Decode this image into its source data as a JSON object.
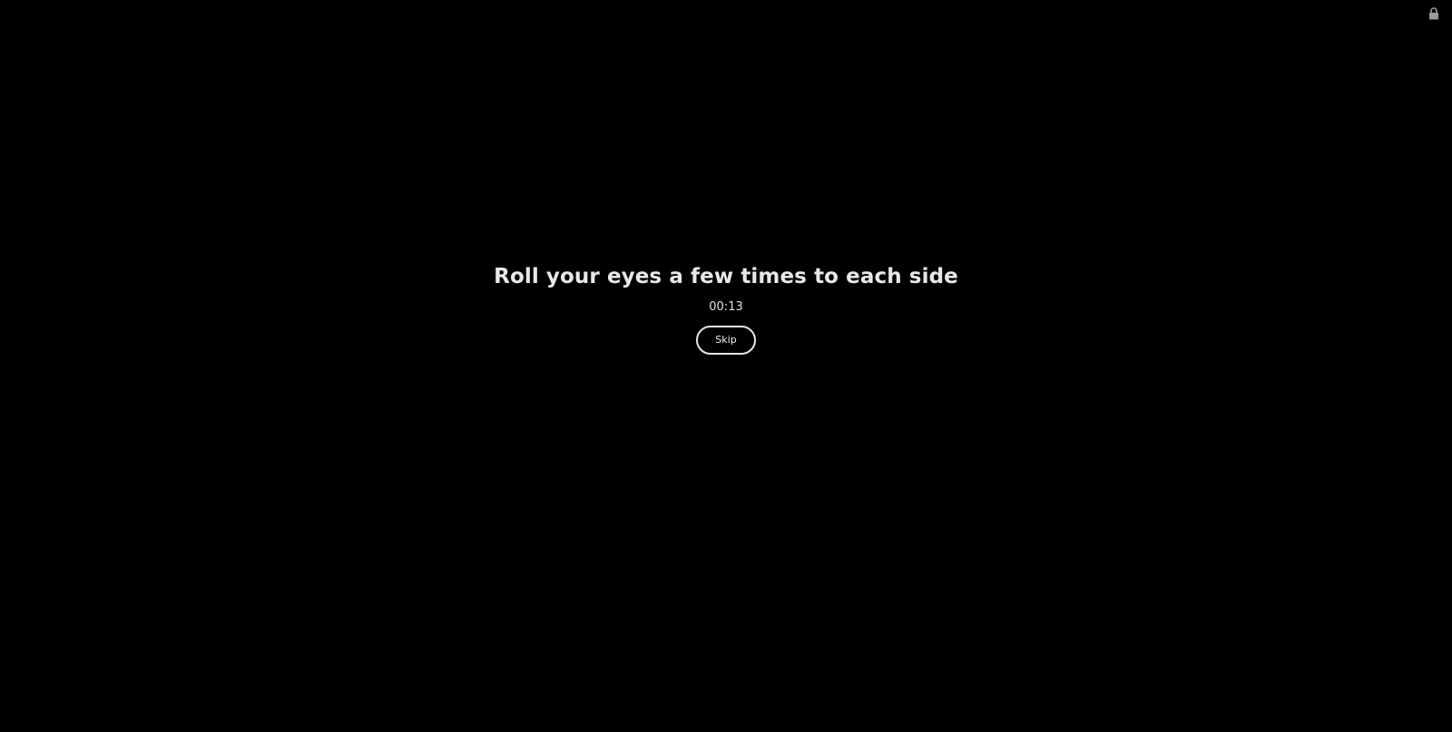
{
  "colors": {
    "background": "#000000",
    "text": "#e8e8e8",
    "button_border": "#e6e6e6",
    "lock_icon": "#9a9a9a"
  },
  "toolbar": {
    "lock_icon": "lock-icon"
  },
  "break_screen": {
    "title": "Roll your eyes a few times to each side",
    "timer": "00:13",
    "skip_label": "Skip"
  }
}
